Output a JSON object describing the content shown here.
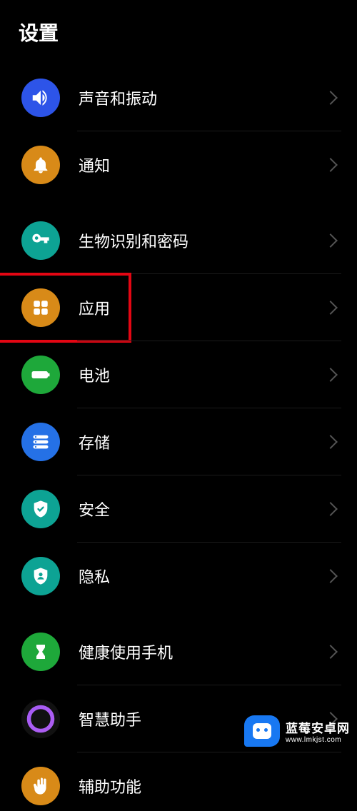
{
  "header": {
    "title": "设置"
  },
  "groups": [
    {
      "items": [
        {
          "id": "sound",
          "label": "声音和振动",
          "icon": "sound-icon",
          "color": "ic-blue"
        },
        {
          "id": "notifications",
          "label": "通知",
          "icon": "bell-icon",
          "color": "ic-orange"
        }
      ]
    },
    {
      "items": [
        {
          "id": "biometrics",
          "label": "生物识别和密码",
          "icon": "key-icon",
          "color": "ic-teal"
        },
        {
          "id": "apps",
          "label": "应用",
          "icon": "apps-icon",
          "color": "ic-orange",
          "highlight": true
        },
        {
          "id": "battery",
          "label": "电池",
          "icon": "battery-icon",
          "color": "ic-green"
        },
        {
          "id": "storage",
          "label": "存储",
          "icon": "storage-icon",
          "color": "ic-blue2"
        },
        {
          "id": "security",
          "label": "安全",
          "icon": "shield-check-icon",
          "color": "ic-teal"
        },
        {
          "id": "privacy",
          "label": "隐私",
          "icon": "shield-user-icon",
          "color": "ic-teal"
        }
      ]
    },
    {
      "items": [
        {
          "id": "digital-wellbeing",
          "label": "健康使用手机",
          "icon": "hourglass-icon",
          "color": "ic-green"
        },
        {
          "id": "assistant",
          "label": "智慧助手",
          "icon": "ring-icon",
          "color": "ic-purple"
        },
        {
          "id": "accessibility",
          "label": "辅助功能",
          "icon": "hand-icon",
          "color": "ic-orange"
        }
      ]
    }
  ],
  "watermark": {
    "brand": "蓝莓安卓网",
    "url": "www.lmkjst.com"
  }
}
